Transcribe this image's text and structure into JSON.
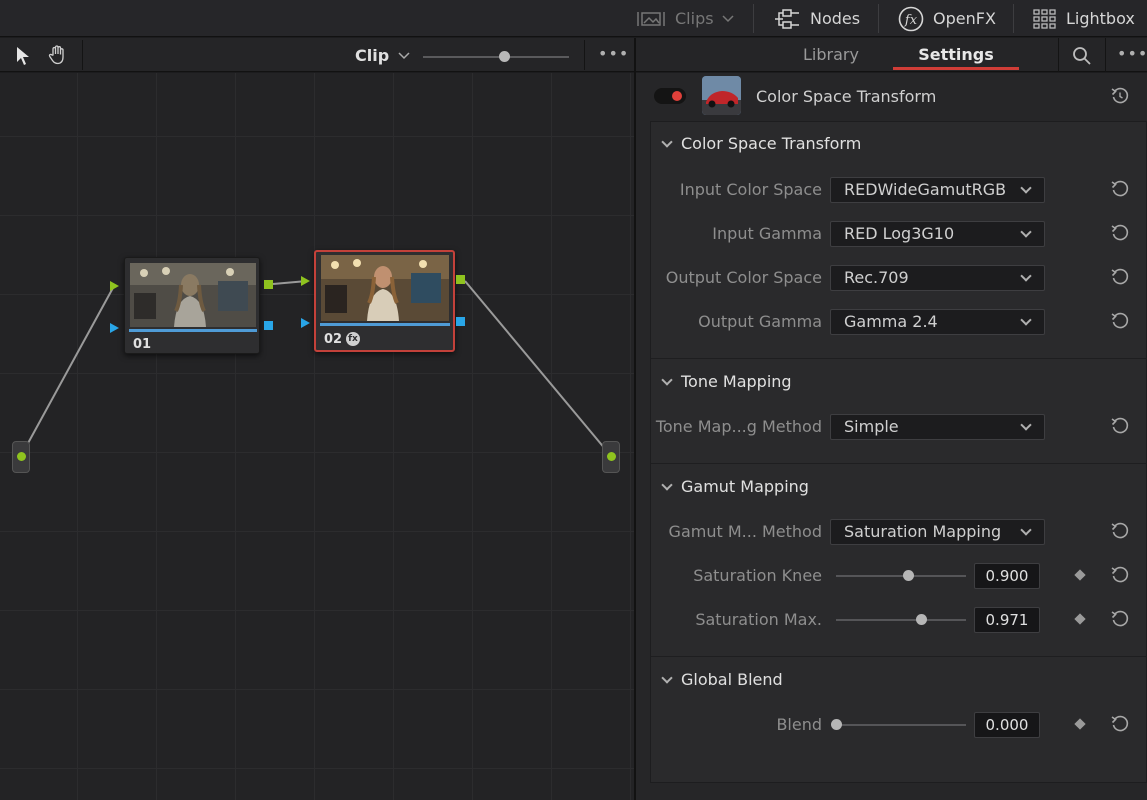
{
  "topbar": {
    "clips_label": "Clips",
    "nodes_label": "Nodes",
    "openfx_label": "OpenFX",
    "lightbox_label": "Lightbox"
  },
  "node_editor": {
    "clip_selector_label": "Clip",
    "nodes": [
      {
        "label": "01"
      },
      {
        "label": "02"
      }
    ]
  },
  "settings_panel": {
    "tabs": [
      {
        "label": "Library",
        "active": false
      },
      {
        "label": "Settings",
        "active": true
      }
    ],
    "effect_title": "Color Space Transform",
    "effect_enabled": true,
    "sections": {
      "cst": {
        "title": "Color Space Transform",
        "input_color_space": {
          "label": "Input Color Space",
          "value": "REDWideGamutRGB"
        },
        "input_gamma": {
          "label": "Input Gamma",
          "value": "RED Log3G10"
        },
        "output_color_space": {
          "label": "Output Color Space",
          "value": "Rec.709"
        },
        "output_gamma": {
          "label": "Output Gamma",
          "value": "Gamma 2.4"
        }
      },
      "tone": {
        "title": "Tone Mapping",
        "method": {
          "label": "Tone Map...g Method",
          "value": "Simple"
        }
      },
      "gamut": {
        "title": "Gamut Mapping",
        "method": {
          "label": "Gamut M... Method",
          "value": "Saturation Mapping"
        },
        "sat_knee": {
          "label": "Saturation Knee",
          "value": "0.900"
        },
        "sat_max": {
          "label": "Saturation Max.",
          "value": "0.971"
        }
      },
      "blend": {
        "title": "Global Blend",
        "blend": {
          "label": "Blend",
          "value": "0.000"
        }
      }
    }
  },
  "colors": {
    "accent_red": "#d03d37",
    "port_green": "#8fc31f",
    "port_blue": "#29a6e8"
  }
}
